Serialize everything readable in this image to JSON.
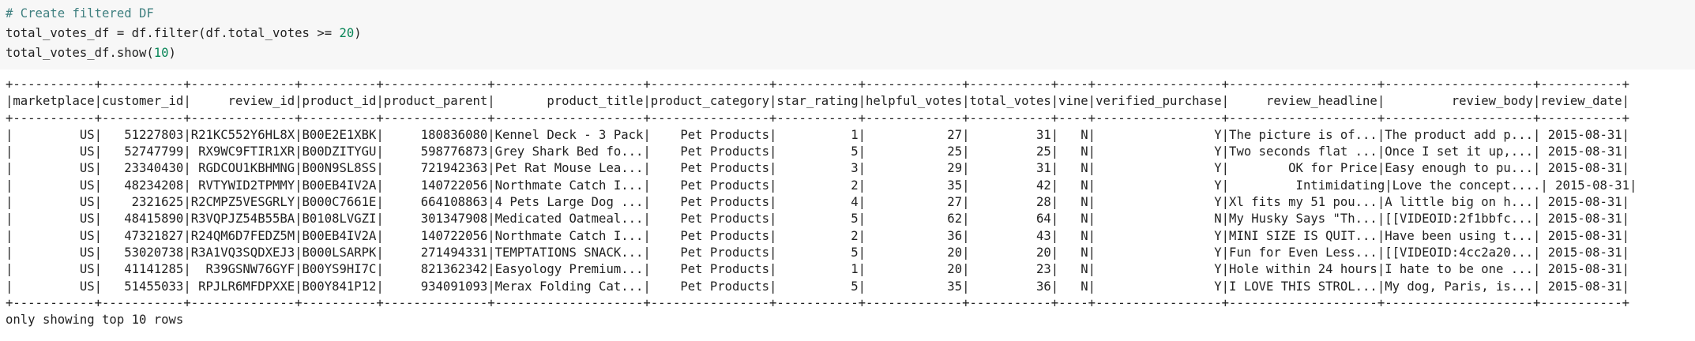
{
  "code": {
    "comment": "# Create filtered DF",
    "line2_var": "total_votes_df",
    "line2_eq": " = df.",
    "line2_func": "filter",
    "line2_args_pre": "(df.total_votes >= ",
    "line2_num": "20",
    "line2_close": ")",
    "line3_pre": "total_votes_df.show(",
    "line3_num": "10",
    "line3_close": ")"
  },
  "output": {
    "lines": [
      "+-----------+-----------+--------------+----------+--------------+--------------------+----------------+-----------+-------------+-----------+----+-----------------+--------------------+--------------------+-----------+",
      "|marketplace|customer_id|     review_id|product_id|product_parent|       product_title|product_category|star_rating|helpful_votes|total_votes|vine|verified_purchase|     review_headline|         review_body|review_date|",
      "+-----------+-----------+--------------+----------+--------------+--------------------+----------------+-----------+-------------+-----------+----+-----------------+--------------------+--------------------+-----------+",
      "|         US|   51227803|R21KC552Y6HL8X|B00E2E1XBK|     180836080|Kennel Deck - 3 Pack|    Pet Products|          1|           27|         31|   N|                Y|The picture is of...|The product add p...| 2015-08-31|",
      "|         US|   52747799| RX9WC9FTIR1XR|B00DZITYGU|     598776873|Grey Shark Bed fo...|    Pet Products|          5|           25|         25|   N|                Y|Two seconds flat ...|Once I set it up,...| 2015-08-31|",
      "|         US|   23340430| RGDCOU1KBHMNG|B00N9SL8SS|     721942363|Pet Rat Mouse Lea...|    Pet Products|          3|           29|         31|   N|                Y|        OK for Price|Easy enough to pu...| 2015-08-31|",
      "|         US|   48234208| RVTYWID2TPMMY|B00EB4IV2A|     140722056|Northmate Catch I...|    Pet Products|          2|           35|         42|   N|                Y|         Intimidating|Love the concept....| 2015-08-31|",
      "|         US|    2321625|R2CMPZ5VESGRLY|B000C7661E|     664108863|4 Pets Large Dog ...|    Pet Products|          4|           27|         28|   N|                Y|Xl fits my 51 pou...|A little big on h...| 2015-08-31|",
      "|         US|   48415890|R3VQPJZ54B55BA|B0108LVGZI|     301347908|Medicated Oatmeal...|    Pet Products|          5|           62|         64|   N|                N|My Husky Says \"Th...|[[VIDEOID:2f1bbfc...| 2015-08-31|",
      "|         US|   47321827|R24QM6D7FEDZ5M|B00EB4IV2A|     140722056|Northmate Catch I...|    Pet Products|          2|           36|         43|   N|                Y|MINI SIZE IS QUIT...|Have been using t...| 2015-08-31|",
      "|         US|   53020738|R3A1VQ3SQDXEJ3|B000LSARPK|     271494331|TEMPTATIONS SNACK...|    Pet Products|          5|           20|         20|   N|                Y|Fun for Even Less...|[[VIDEOID:4cc2a20...| 2015-08-31|",
      "|         US|   41141285|  R39GSNW76GYF|B00YS9HI7C|     821362342|Easyology Premium...|    Pet Products|          1|           20|         23|   N|                Y|Hole within 24 hours|I hate to be one ...| 2015-08-31|",
      "|         US|   51455033| RPJLR6MFDPXXE|B00Y841P12|     934091093|Merax Folding Cat...|    Pet Products|          5|           35|         36|   N|                Y|I LOVE THIS STROL...|My dog, Paris, is...| 2015-08-31|",
      "+-----------+-----------+--------------+----------+--------------+--------------------+----------------+-----------+-------------+-----------+----+-----------------+--------------------+--------------------+-----------+",
      "only showing top 10 rows"
    ]
  }
}
